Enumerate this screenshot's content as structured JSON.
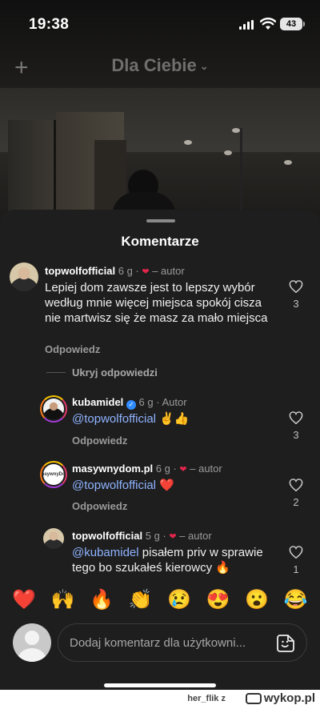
{
  "status_bar": {
    "time": "19:38",
    "battery": "43"
  },
  "top_bar": {
    "feed_title": "Dla Ciebie"
  },
  "sheet": {
    "title": "Komentarze"
  },
  "comments": [
    {
      "username": "topwolfofficial",
      "time": "6 g",
      "author_tag": "– autor",
      "text": "Lepiej dom zawsze jest to lepszy wybór według mnie więcej miejsca spokój cisza nie martwisz się że masz za mało miejsca",
      "reply_label": "Odpowiedz",
      "likes": "3"
    }
  ],
  "hide_replies_label": "Ukryj odpowiedzi",
  "replies": [
    {
      "username": "kubamidel",
      "time": "6 g",
      "author_tag": "Autor",
      "mention": "@topwolfofficial",
      "text": " ✌️👍",
      "reply_label": "Odpowiedz",
      "likes": "3"
    },
    {
      "username": "masywnydom.pl",
      "time": "6 g",
      "author_tag": "– autor",
      "mention": "@topwolfofficial",
      "text": " ❤️",
      "reply_label": "Odpowiedz",
      "likes": "2"
    },
    {
      "username": "topwolfofficial",
      "time": "5 g",
      "author_tag": "– autor",
      "mention": "@kubamidel",
      "text": " pisałem priv w sprawie tego bo szukałeś kierowcy 🔥",
      "likes": "1"
    }
  ],
  "emoji_bar": [
    "❤️",
    "🙌",
    "🔥",
    "👏",
    "😢",
    "😍",
    "😮",
    "😂"
  ],
  "composer": {
    "placeholder": "Dodaj komentarz dla użytkowni..."
  },
  "watermark": {
    "user": "her_flik",
    "z": "z",
    "site": "wykop.pl"
  },
  "colors": {
    "sheet_bg": "#1e1e1e",
    "heart": "#e0264b",
    "mention": "#8fb3ff",
    "verified": "#2f8cff"
  }
}
